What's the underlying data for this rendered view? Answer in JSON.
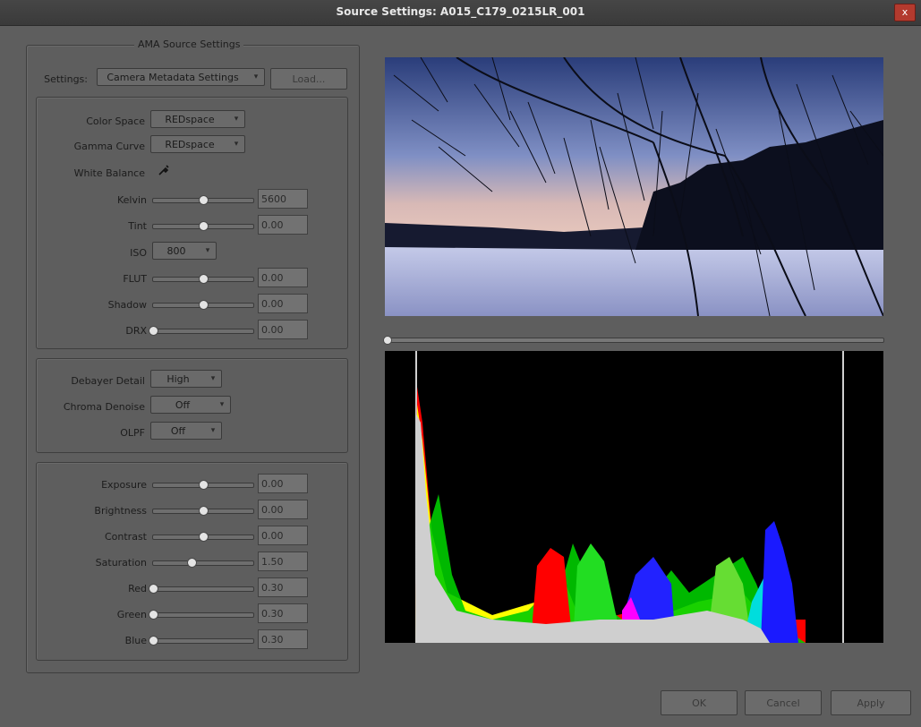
{
  "window": {
    "title": "Source Settings: A015_C179_0215LR_001",
    "close_label": "x"
  },
  "ama": {
    "group_title": "AMA Source Settings",
    "settings_label": "Settings:",
    "settings_value": "Camera Metadata Settings",
    "load_label": "Load..."
  },
  "color": {
    "color_space_label": "Color Space",
    "color_space_value": "REDspace",
    "gamma_label": "Gamma Curve",
    "gamma_value": "REDspace",
    "white_balance_label": "White Balance",
    "kelvin_label": "Kelvin",
    "kelvin_value": "5600",
    "kelvin_level": 0.5,
    "tint_label": "Tint",
    "tint_value": "0.00",
    "tint_level": 0.5,
    "iso_label": "ISO",
    "iso_value": "800",
    "flut_label": "FLUT",
    "flut_value": "0.00",
    "flut_level": 0.5,
    "shadow_label": "Shadow",
    "shadow_value": "0.00",
    "shadow_level": 0.5,
    "drx_label": "DRX",
    "drx_value": "0.00",
    "drx_level": 0.0
  },
  "debayer": {
    "detail_label": "Debayer Detail",
    "detail_value": "High",
    "denoise_label": "Chroma Denoise",
    "denoise_value": "Off",
    "olpf_label": "OLPF",
    "olpf_value": "Off"
  },
  "grading": {
    "exposure_label": "Exposure",
    "exposure_value": "0.00",
    "exposure_level": 0.5,
    "brightness_label": "Brightness",
    "brightness_value": "0.00",
    "brightness_level": 0.5,
    "contrast_label": "Contrast",
    "contrast_value": "0.00",
    "contrast_level": 0.5,
    "saturation_label": "Saturation",
    "saturation_value": "1.50",
    "saturation_level": 0.38,
    "red_label": "Red",
    "red_value": "0.30",
    "red_level": 0.0,
    "green_label": "Green",
    "green_value": "0.30",
    "green_level": 0.0,
    "blue_label": "Blue",
    "blue_value": "0.30",
    "blue_level": 0.0
  },
  "footer": {
    "ok_label": "OK",
    "cancel_label": "Cancel",
    "apply_label": "Apply"
  },
  "playback": {
    "position": 0.0
  },
  "icons": {
    "close": "close-icon",
    "eyedropper": "eyedropper-icon",
    "dropdown": "chevron-down-icon"
  }
}
